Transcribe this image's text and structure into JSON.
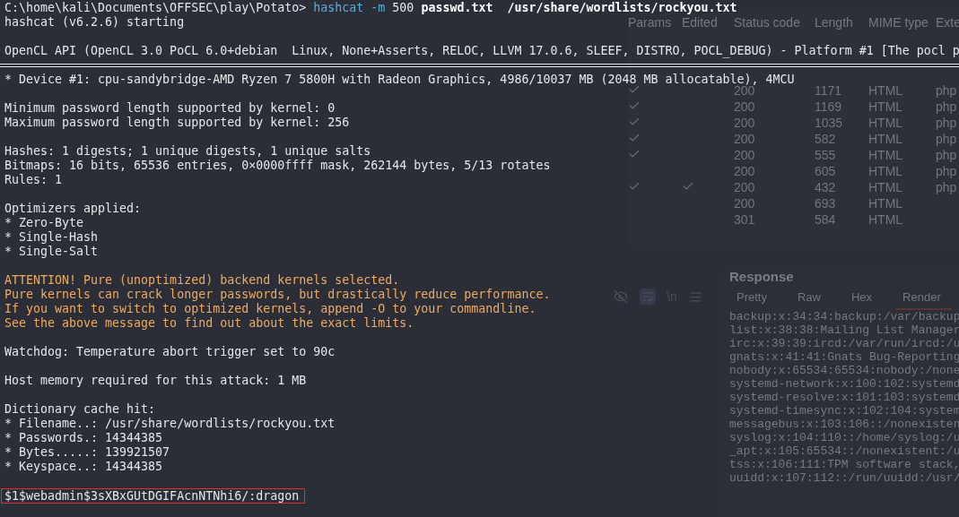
{
  "terminal": {
    "prompt": {
      "path": "C:\\home\\kali\\Documents\\OFFSEC\\play\\Potato>",
      "command": "hashcat",
      "flag": "-m",
      "number": "500",
      "args": "passwd.txt  /usr/share/wordlists/rockyou.txt"
    },
    "lines": [
      {
        "kind": "text",
        "text": "hashcat (v6.2.6) starting"
      },
      {
        "kind": "blank"
      },
      {
        "kind": "text",
        "text": "OpenCL API (OpenCL 3.0 PoCL 6.0+debian  Linux, None+Asserts, RELOC, LLVM 17.0.6, SLEEF, DISTRO, POCL_DEBUG) - Platform #1 [The pocl p"
      },
      {
        "kind": "rule"
      },
      {
        "kind": "text",
        "text": "* Device #1: cpu-sandybridge-AMD Ryzen 7 5800H with Radeon Graphics, 4986/10037 MB (2048 MB allocatable), 4MCU"
      },
      {
        "kind": "blank"
      },
      {
        "kind": "text",
        "text": "Minimum password length supported by kernel: 0"
      },
      {
        "kind": "text",
        "text": "Maximum password length supported by kernel: 256"
      },
      {
        "kind": "blank"
      },
      {
        "kind": "text",
        "text": "Hashes: 1 digests; 1 unique digests, 1 unique salts"
      },
      {
        "kind": "text",
        "text": "Bitmaps: 16 bits, 65536 entries, 0×0000ffff mask, 262144 bytes, 5/13 rotates"
      },
      {
        "kind": "text",
        "text": "Rules: 1"
      },
      {
        "kind": "blank"
      },
      {
        "kind": "text",
        "text": "Optimizers applied:"
      },
      {
        "kind": "text",
        "text": "* Zero-Byte"
      },
      {
        "kind": "text",
        "text": "* Single-Hash"
      },
      {
        "kind": "text",
        "text": "* Single-Salt"
      },
      {
        "kind": "blank"
      },
      {
        "kind": "warning",
        "text": "ATTENTION! Pure (unoptimized) backend kernels selected."
      },
      {
        "kind": "warning",
        "text": "Pure kernels can crack longer passwords, but drastically reduce performance."
      },
      {
        "kind": "warning",
        "text": "If you want to switch to optimized kernels, append -O to your commandline."
      },
      {
        "kind": "warning",
        "text": "See the above message to find out about the exact limits."
      },
      {
        "kind": "blank"
      },
      {
        "kind": "text",
        "text": "Watchdog: Temperature abort trigger set to 90c"
      },
      {
        "kind": "blank"
      },
      {
        "kind": "text",
        "text": "Host memory required for this attack: 1 MB"
      },
      {
        "kind": "blank"
      },
      {
        "kind": "text",
        "text": "Dictionary cache hit:"
      },
      {
        "kind": "text",
        "text": "* Filename..: /usr/share/wordlists/rockyou.txt"
      },
      {
        "kind": "text",
        "text": "* Passwords.: 14344385"
      },
      {
        "kind": "text",
        "text": "* Bytes.....: 139921507"
      },
      {
        "kind": "text",
        "text": "* Keyspace..: 14344385"
      },
      {
        "kind": "blank"
      },
      {
        "kind": "result",
        "text": "$1$webadmin$3sXBxGUtDGIFAcnNTNhi6/:dragon"
      }
    ]
  },
  "history_table": {
    "columns": [
      "Params",
      "Edited",
      "Status code",
      "Length",
      "MIME type",
      "Exte"
    ],
    "rows": [
      {
        "params": true,
        "edited": false,
        "status": "200",
        "length": "1171",
        "mime": "HTML",
        "ext": "php"
      },
      {
        "params": true,
        "edited": false,
        "status": "200",
        "length": "1169",
        "mime": "HTML",
        "ext": "php"
      },
      {
        "params": true,
        "edited": false,
        "status": "200",
        "length": "1035",
        "mime": "HTML",
        "ext": "php"
      },
      {
        "params": true,
        "edited": false,
        "status": "200",
        "length": "582",
        "mime": "HTML",
        "ext": "php"
      },
      {
        "params": true,
        "edited": false,
        "status": "200",
        "length": "555",
        "mime": "HTML",
        "ext": "php"
      },
      {
        "params": false,
        "edited": false,
        "status": "200",
        "length": "605",
        "mime": "HTML",
        "ext": "php"
      },
      {
        "params": true,
        "edited": true,
        "status": "200",
        "length": "432",
        "mime": "HTML",
        "ext": "php"
      },
      {
        "params": false,
        "edited": false,
        "status": "200",
        "length": "693",
        "mime": "HTML"
      },
      {
        "params": false,
        "edited": false,
        "status": "301",
        "length": "584",
        "mime": "HTML"
      }
    ]
  },
  "editor_toolbar": {
    "newline_toggle": "\\n",
    "wrap_on": true
  },
  "response": {
    "title": "Response",
    "tabs": [
      {
        "label": "Pretty",
        "selected": false
      },
      {
        "label": "Raw",
        "selected": false
      },
      {
        "label": "Hex",
        "selected": false
      },
      {
        "label": "Render",
        "selected": true
      }
    ],
    "lines": [
      "backup:x:34:34:backup:/var/backup",
      "list:x:38:38:Mailing List Manager",
      "irc:x:39:39:ircd:/var/run/ircd:/u",
      "gnats:x:41:41:Gnats Bug-Reporting",
      "nobody:x:65534:65534:nobody:/none",
      "systemd-network:x:100:102:systemd",
      "systemd-resolve:x:101:103:systemd",
      "systemd-timesync:x:102:104:system",
      "messagebus:x:103:106::/nonexisten",
      "syslog:x:104:110::/home/syslog:/u",
      "_apt:x:105:65534::/nonexistent:/u",
      "tss:x:106:111:TPM software stack,",
      "uuidd:x:107:112::/run/uuidd:/usr/"
    ]
  }
}
